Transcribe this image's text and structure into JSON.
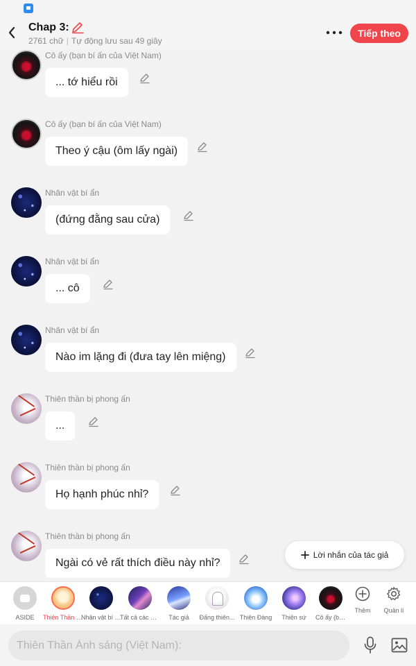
{
  "colors": {
    "accent": "#f0454b",
    "background": "#f2f2f2",
    "bubble": "#ffffff"
  },
  "header": {
    "title": "Chap 3:",
    "word_count": "2761 chữ",
    "autosave": "Tự động lưu sau 49 giây",
    "next_label": "Tiếp theo",
    "icons": {
      "back": "chevron-left-icon",
      "title_edit": "pencil-icon",
      "more": "more-dots-icon"
    }
  },
  "messages": [
    {
      "name": "Cô ấy (bạn bí ấn của Việt Nam)",
      "text": "... tớ hiểu rồi",
      "avatar": "girl-red-portrait"
    },
    {
      "name": "Cô ấy (bạn bí ấn của Việt Nam)",
      "text": "Theo ý cậu (ôm lấy ngài)",
      "avatar": "girl-red-portrait"
    },
    {
      "name": "Nhân vật bí ẩn",
      "text": "(đứng đằng sau cửa)",
      "avatar": "starry-night"
    },
    {
      "name": "Nhân vật bí ẩn",
      "text": "... cô",
      "avatar": "starry-night"
    },
    {
      "name": "Nhân vật bí ẩn",
      "text": "Nào im lặng đi (đưa tay lên miệng)",
      "avatar": "starry-night"
    },
    {
      "name": "Thiên thần bị phong ấn",
      "text": "...",
      "avatar": "white-angel"
    },
    {
      "name": "Thiên thần bị phong ấn",
      "text": "Họ hạnh phúc nhỉ?",
      "avatar": "white-angel"
    },
    {
      "name": "Thiên thần bị phong ấn",
      "text": "Ngài có vẻ rất thích điều này nhỉ?",
      "avatar": "white-angel"
    }
  ],
  "author_note_button": {
    "label": "Lời nhắn của tác giả",
    "icon": "plus-icon"
  },
  "character_bar": {
    "items": [
      {
        "label": "ASIDE",
        "selected": false
      },
      {
        "label": "Thiên Thần Ánh sáng (Việt Nam)",
        "selected": true
      },
      {
        "label": "Nhân vật bí ẩn",
        "selected": false
      },
      {
        "label": "Tất cả các nhân vật",
        "selected": false
      },
      {
        "label": "Tác giả",
        "selected": false
      },
      {
        "label": "Đấng thiên...",
        "selected": false
      },
      {
        "label": "Thiên Đàng",
        "selected": false
      },
      {
        "label": "Thiên sứ",
        "selected": false
      },
      {
        "label": "Cô ấy (bạn bí ấn của Việt Nam)",
        "selected": false
      }
    ],
    "tools": [
      {
        "label": "Thêm",
        "icon": "plus-circle-icon"
      },
      {
        "label": "Quản lí",
        "icon": "gear-icon"
      }
    ]
  },
  "composer": {
    "placeholder": "Thiên Thần Ánh sáng (Việt Nam):",
    "icons": {
      "mic": "microphone-icon",
      "image": "image-icon"
    }
  }
}
